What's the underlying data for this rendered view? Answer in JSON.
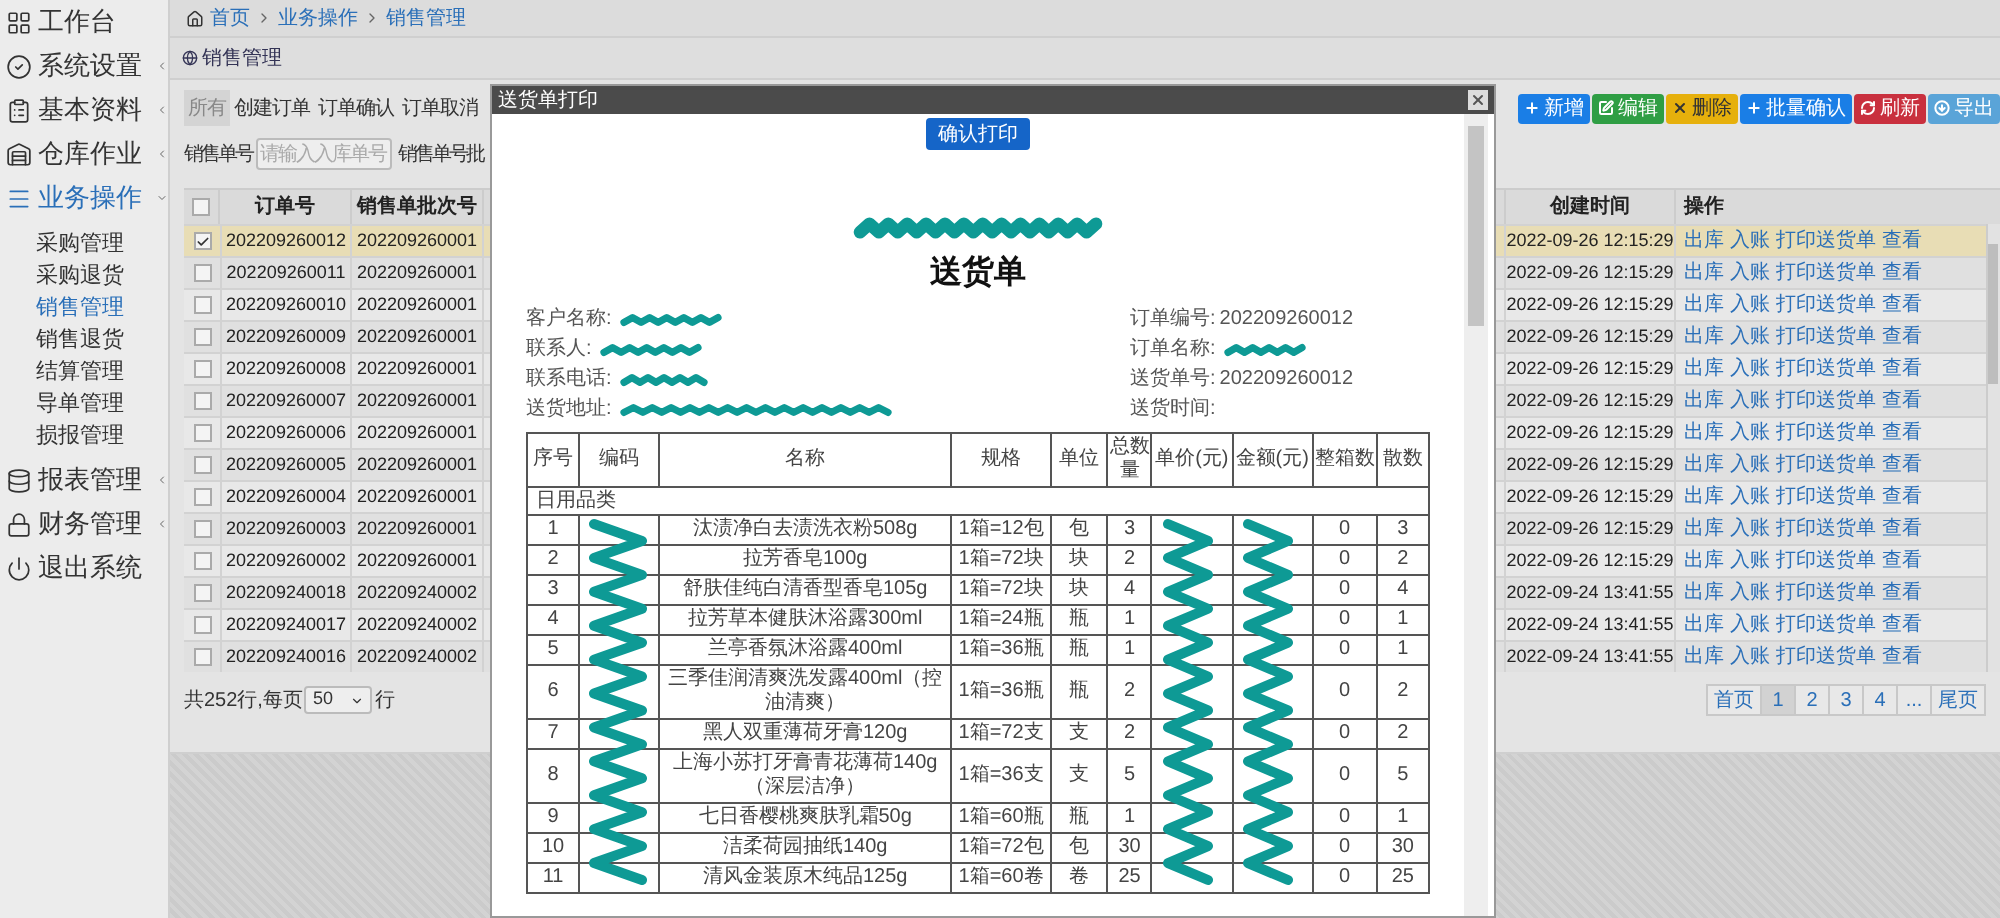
{
  "sidebar": {
    "items": [
      {
        "label": "工作台",
        "kind": "link"
      },
      {
        "label": "系统设置",
        "kind": "menu",
        "expanded": false
      },
      {
        "label": "基本资料",
        "kind": "menu",
        "expanded": false
      },
      {
        "label": "仓库作业",
        "kind": "menu",
        "expanded": false
      },
      {
        "label": "业务操作",
        "kind": "menu",
        "expanded": true,
        "children": [
          {
            "label": "采购管理",
            "selected": false
          },
          {
            "label": "采购退货",
            "selected": false
          },
          {
            "label": "销售管理",
            "selected": true
          },
          {
            "label": "销售退货",
            "selected": false
          },
          {
            "label": "结算管理",
            "selected": false
          },
          {
            "label": "导单管理",
            "selected": false
          },
          {
            "label": "损报管理",
            "selected": false
          }
        ]
      },
      {
        "label": "报表管理",
        "kind": "menu",
        "expanded": false
      },
      {
        "label": "财务管理",
        "kind": "menu",
        "expanded": false
      },
      {
        "label": "退出系统",
        "kind": "link"
      }
    ]
  },
  "breadcrumb": [
    "首页",
    "业务操作",
    "销售管理"
  ],
  "panel_title": "销售管理",
  "tabs": [
    {
      "label": "所有",
      "selected": true
    },
    {
      "label": "创建订单",
      "selected": false
    },
    {
      "label": "订单确认",
      "selected": false
    },
    {
      "label": "订单取消",
      "selected": false
    }
  ],
  "toolbar": [
    {
      "label": "新增",
      "kind": "add"
    },
    {
      "label": "编辑",
      "kind": "edit"
    },
    {
      "label": "删除",
      "kind": "delete"
    },
    {
      "label": "批量确认",
      "kind": "add"
    },
    {
      "label": "刷新",
      "kind": "refresh"
    },
    {
      "label": "导出",
      "kind": "export"
    }
  ],
  "search": {
    "label": "销售单号",
    "placeholder": "请输入入库单号",
    "label_2": "销售单号批"
  },
  "table": {
    "all_checked": false,
    "columns": [
      "订单号",
      "销售单批次号",
      "创建时间",
      "操作"
    ],
    "rows": [
      {
        "checked": true,
        "selected": true,
        "order_no": "202209260012",
        "batch_no": "202209260001",
        "created": "2022-09-26 12:15:29",
        "actions": [
          "出库",
          "入账",
          "打印送货单",
          "查看"
        ]
      },
      {
        "checked": false,
        "selected": false,
        "order_no": "202209260011",
        "batch_no": "202209260001",
        "created": "2022-09-26 12:15:29",
        "actions": [
          "出库",
          "入账",
          "打印送货单",
          "查看"
        ]
      },
      {
        "checked": false,
        "selected": false,
        "order_no": "202209260010",
        "batch_no": "202209260001",
        "created": "2022-09-26 12:15:29",
        "actions": [
          "出库",
          "入账",
          "打印送货单",
          "查看"
        ]
      },
      {
        "checked": false,
        "selected": false,
        "order_no": "202209260009",
        "batch_no": "202209260001",
        "created": "2022-09-26 12:15:29",
        "actions": [
          "出库",
          "入账",
          "打印送货单",
          "查看"
        ]
      },
      {
        "checked": false,
        "selected": false,
        "order_no": "202209260008",
        "batch_no": "202209260001",
        "created": "2022-09-26 12:15:29",
        "actions": [
          "出库",
          "入账",
          "打印送货单",
          "查看"
        ]
      },
      {
        "checked": false,
        "selected": false,
        "order_no": "202209260007",
        "batch_no": "202209260001",
        "created": "2022-09-26 12:15:29",
        "actions": [
          "出库",
          "入账",
          "打印送货单",
          "查看"
        ]
      },
      {
        "checked": false,
        "selected": false,
        "order_no": "202209260006",
        "batch_no": "202209260001",
        "created": "2022-09-26 12:15:29",
        "actions": [
          "出库",
          "入账",
          "打印送货单",
          "查看"
        ]
      },
      {
        "checked": false,
        "selected": false,
        "order_no": "202209260005",
        "batch_no": "202209260001",
        "created": "2022-09-26 12:15:29",
        "actions": [
          "出库",
          "入账",
          "打印送货单",
          "查看"
        ]
      },
      {
        "checked": false,
        "selected": false,
        "order_no": "202209260004",
        "batch_no": "202209260001",
        "created": "2022-09-26 12:15:29",
        "actions": [
          "出库",
          "入账",
          "打印送货单",
          "查看"
        ]
      },
      {
        "checked": false,
        "selected": false,
        "order_no": "202209260003",
        "batch_no": "202209260001",
        "created": "2022-09-26 12:15:29",
        "actions": [
          "出库",
          "入账",
          "打印送货单",
          "查看"
        ]
      },
      {
        "checked": false,
        "selected": false,
        "order_no": "202209260002",
        "batch_no": "202209260001",
        "created": "2022-09-26 12:15:29",
        "actions": [
          "出库",
          "入账",
          "打印送货单",
          "查看"
        ]
      },
      {
        "checked": false,
        "selected": false,
        "order_no": "202209240018",
        "batch_no": "202209240002",
        "created": "2022-09-24 13:41:55",
        "actions": [
          "出库",
          "入账",
          "打印送货单",
          "查看"
        ]
      },
      {
        "checked": false,
        "selected": false,
        "order_no": "202209240017",
        "batch_no": "202209240002",
        "created": "2022-09-24 13:41:55",
        "actions": [
          "出库",
          "入账",
          "打印送货单",
          "查看"
        ]
      },
      {
        "checked": false,
        "selected": false,
        "order_no": "202209240016",
        "batch_no": "202209240002",
        "created": "2022-09-24 13:41:55",
        "actions": [
          "出库",
          "入账",
          "打印送货单",
          "查看"
        ]
      }
    ]
  },
  "footer": {
    "total": "共252行,每页",
    "page_size": "50",
    "unit": "行"
  },
  "pagination": [
    {
      "label": "首页",
      "selected": false
    },
    {
      "label": "1",
      "selected": true
    },
    {
      "label": "2",
      "selected": false
    },
    {
      "label": "3",
      "selected": false
    },
    {
      "label": "4",
      "selected": false
    },
    {
      "label": "...",
      "selected": false
    },
    {
      "label": "尾页",
      "selected": false
    }
  ],
  "modal": {
    "title": "送货单打印",
    "print_button": "确认打印",
    "heading": "送货单",
    "info_left": [
      {
        "label": "客户名称:",
        "redacted": true
      },
      {
        "label": "联系人:",
        "redacted": true
      },
      {
        "label": "联系电话:",
        "redacted": true
      },
      {
        "label": "送货地址:",
        "redacted": true
      }
    ],
    "info_right": [
      {
        "label": "订单编号:",
        "value": "202209260012",
        "redacted": false
      },
      {
        "label": "订单名称:",
        "redacted": true
      },
      {
        "label": "送货单号:",
        "value": "202209260012",
        "redacted": false
      },
      {
        "label": "送货时间:",
        "redacted": false
      }
    ],
    "columns": [
      "序号",
      "编码",
      "名称",
      "规格",
      "单位",
      "总数量",
      "单价(元)",
      "金额(元)",
      "整箱数",
      "散数"
    ],
    "group": "日用品类",
    "rows": [
      {
        "no": "1",
        "name": "汰渍净白去渍洗衣粉508g",
        "spec": "1箱=12包",
        "unit": "包",
        "qty": "3",
        "boxes": "0",
        "loose": "3"
      },
      {
        "no": "2",
        "name": "拉芳香皂100g",
        "spec": "1箱=72块",
        "unit": "块",
        "qty": "2",
        "boxes": "0",
        "loose": "2"
      },
      {
        "no": "3",
        "name": "舒肤佳纯白清香型香皂105g",
        "spec": "1箱=72块",
        "unit": "块",
        "qty": "4",
        "boxes": "0",
        "loose": "4"
      },
      {
        "no": "4",
        "name": "拉芳草本健肤沐浴露300ml",
        "spec": "1箱=24瓶",
        "unit": "瓶",
        "qty": "1",
        "boxes": "0",
        "loose": "1"
      },
      {
        "no": "5",
        "name": "兰亭香氛沐浴露400ml",
        "spec": "1箱=36瓶",
        "unit": "瓶",
        "qty": "1",
        "boxes": "0",
        "loose": "1"
      },
      {
        "no": "6",
        "name": "三季佳润清爽洗发露400ml（控油清爽）",
        "spec": "1箱=36瓶",
        "unit": "瓶",
        "qty": "2",
        "boxes": "0",
        "loose": "2"
      },
      {
        "no": "7",
        "name": "黑人双重薄荷牙膏120g",
        "spec": "1箱=72支",
        "unit": "支",
        "qty": "2",
        "boxes": "0",
        "loose": "2"
      },
      {
        "no": "8",
        "name": "上海小苏打牙膏青花薄荷140g（深层洁净）",
        "spec": "1箱=36支",
        "unit": "支",
        "qty": "5",
        "boxes": "0",
        "loose": "5"
      },
      {
        "no": "9",
        "name": "七日香樱桃爽肤乳霜50g",
        "spec": "1箱=60瓶",
        "unit": "瓶",
        "qty": "1",
        "boxes": "0",
        "loose": "1"
      },
      {
        "no": "10",
        "name": "洁柔荷园抽纸140g",
        "spec": "1箱=72包",
        "unit": "包",
        "qty": "30",
        "boxes": "0",
        "loose": "30"
      },
      {
        "no": "11",
        "name": "清风金装原木纯品125g",
        "spec": "1箱=60卷",
        "unit": "卷",
        "qty": "25",
        "boxes": "0",
        "loose": "25"
      }
    ]
  }
}
